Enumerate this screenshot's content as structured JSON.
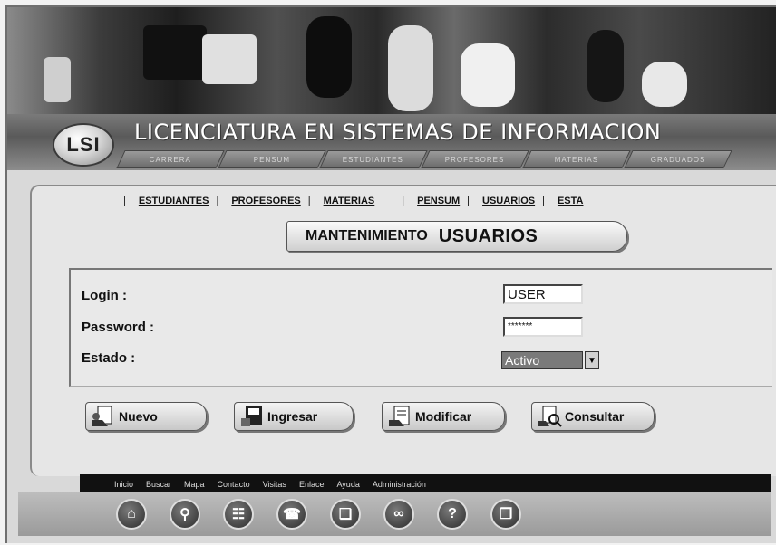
{
  "site": {
    "logo_text": "LSI",
    "title": "LICENCIATURA EN SISTEMAS DE INFORMACION",
    "top_tabs": [
      "CARRERA",
      "PENSUM",
      "ESTUDIANTES",
      "PROFESORES",
      "MATERIAS",
      "GRADUADOS"
    ]
  },
  "subnav": {
    "items": [
      "ESTUDIANTES",
      "PROFESORES",
      "MATERIAS",
      "PENSUM",
      "USUARIOS",
      "ESTA"
    ]
  },
  "heading": {
    "prefix": "MANTENIMIENTO",
    "title": "USUARIOS"
  },
  "form": {
    "login_label": "Login :",
    "login_value": "USER",
    "password_label": "Password :",
    "password_value": "*******",
    "estado_label": "Estado :",
    "estado_value": "Activo",
    "estado_arrow": "▼"
  },
  "buttons": {
    "nuevo": "Nuevo",
    "ingresar": "Ingresar",
    "modificar": "Modificar",
    "consultar": "Consultar"
  },
  "footer": {
    "links": [
      "Inicio",
      "Buscar",
      "Mapa",
      "Contacto",
      "Visitas",
      "Enlace",
      "Ayuda",
      "Administración"
    ],
    "icons": [
      "home-icon",
      "search-icon",
      "sitemap-icon",
      "contact-icon",
      "visits-book-icon",
      "link-icon",
      "help-icon",
      "admin-icon"
    ]
  },
  "colors": {
    "panel": "#e6e6e6",
    "banner_dark": "#1e1e1e",
    "footer_bar": "#111111"
  }
}
